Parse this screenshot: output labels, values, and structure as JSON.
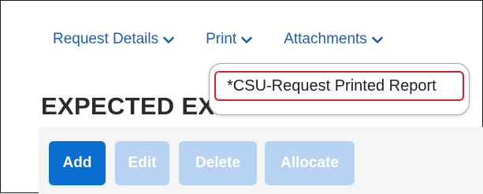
{
  "nav": {
    "items": [
      {
        "label": "Request Details",
        "icon": "chevron-down-icon"
      },
      {
        "label": "Print",
        "icon": "chevron-down-icon"
      },
      {
        "label": "Attachments",
        "icon": "chevron-down-icon"
      }
    ]
  },
  "print_menu": {
    "items": [
      {
        "label": "*CSU-Request Printed Report"
      }
    ]
  },
  "section": {
    "title": "EXPECTED EXPENSES"
  },
  "toolbar": {
    "add_label": "Add",
    "edit_label": "Edit",
    "delete_label": "Delete",
    "allocate_label": "Allocate"
  },
  "colors": {
    "link": "#1a5fb4",
    "primary": "#0a6ed1",
    "disabled": "#b8d3f1",
    "highlight": "#d9232e"
  }
}
